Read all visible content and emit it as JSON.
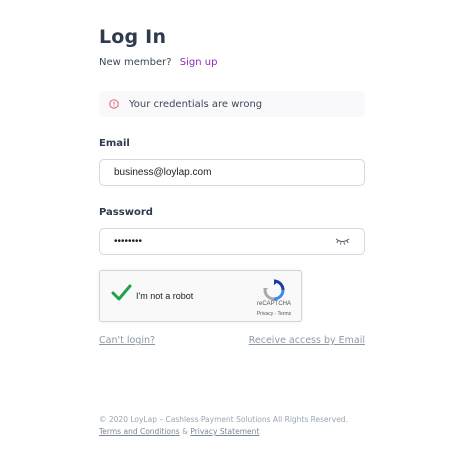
{
  "header": {
    "title": "Log In"
  },
  "signup_row": {
    "prompt": "New member?",
    "link_label": "Sign up"
  },
  "alert": {
    "icon": "alert-circle-icon",
    "message": "Your credentials are wrong",
    "color": "#e0545c"
  },
  "form": {
    "email_label": "Email",
    "email_value": "business@loylap.com",
    "password_label": "Password",
    "password_value": "••••••••",
    "eye_icon": "eye-closed-icon"
  },
  "captcha": {
    "label": "I'm not a robot",
    "brand": "reCAPTCHA",
    "terms": "Privacy - Terms",
    "checked": true
  },
  "links": {
    "cant_login": "Can't login?",
    "receive_access": "Receive access by Email"
  },
  "footer": {
    "copyright": "© 2020 LoyLap – Cashless Payment Solutions All Rights Reserved.",
    "terms": "Terms and Conditions",
    "separator": "&",
    "privacy": "Privacy Statement"
  },
  "colors": {
    "accent": "#8c2bbf",
    "check": "#1fa34a",
    "link": "#8c98a8"
  }
}
